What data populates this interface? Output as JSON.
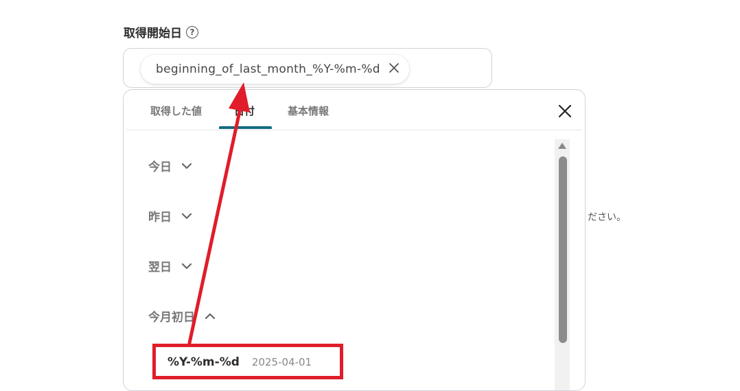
{
  "field": {
    "label": "取得開始日",
    "help_icon": "?",
    "chip_value": "beginning_of_last_month_%Y-%m-%d"
  },
  "background_text": "ださい。",
  "panel": {
    "tabs": [
      {
        "label": "取得した値"
      },
      {
        "label": "日付"
      },
      {
        "label": "基本情報"
      }
    ],
    "groups": [
      {
        "label": "今日",
        "state": "collapsed"
      },
      {
        "label": "昨日",
        "state": "collapsed"
      },
      {
        "label": "翌日",
        "state": "collapsed"
      },
      {
        "label": "今月初日",
        "state": "expanded"
      }
    ],
    "format_item": {
      "pattern": "%Y-%m-%d",
      "example": "2025-04-01"
    }
  },
  "icons": {
    "chip_close": "close-icon",
    "panel_close": "close-icon",
    "chevron_collapsed": "chevron-down-icon",
    "chevron_expanded": "chevron-up-icon"
  },
  "colors": {
    "accent": "#146b80",
    "annotation": "#e01d2a"
  }
}
